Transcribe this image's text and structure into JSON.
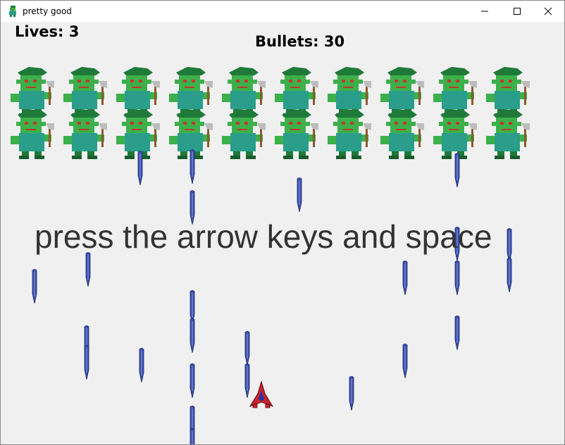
{
  "window": {
    "title": "pretty good",
    "icons": {
      "app": "goblin-icon",
      "minimize": "minimize-icon",
      "maximize": "maximize-icon",
      "close": "close-icon"
    }
  },
  "hud": {
    "lives_label": "Lives: 3",
    "lives": 3,
    "bullets_label": "Bullets: 30",
    "bullets": 30
  },
  "prompt": "press the arrow keys and space",
  "enemies": {
    "rows": 2,
    "cols": 10,
    "sprite": "green-goblin-with-axe"
  },
  "colors": {
    "goblin_body": "#2a9e8a",
    "goblin_hat": "#1f7a3a",
    "goblin_skin": "#3cb04a",
    "bullet": "#3a4fb0",
    "ship": "#c8232c",
    "ship_cockpit": "#2234a8"
  }
}
